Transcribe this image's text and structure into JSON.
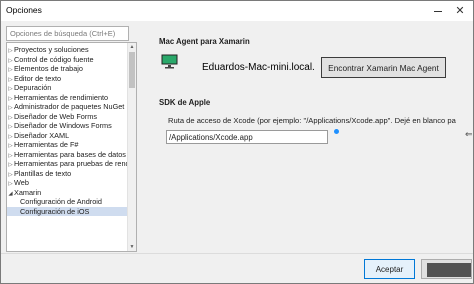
{
  "window": {
    "title": "Opciones"
  },
  "search": {
    "placeholder": "Opciones de búsqueda (Ctrl+E)"
  },
  "tree": {
    "items": [
      {
        "label": "Proyectos y soluciones",
        "expander": "▷",
        "level": 0,
        "selected": false
      },
      {
        "label": "Control de código fuente",
        "expander": "▷",
        "level": 0,
        "selected": false
      },
      {
        "label": "Elementos de trabajo",
        "expander": "▷",
        "level": 0,
        "selected": false
      },
      {
        "label": "Editor de texto",
        "expander": "▷",
        "level": 0,
        "selected": false
      },
      {
        "label": "Depuración",
        "expander": "▷",
        "level": 0,
        "selected": false
      },
      {
        "label": "Herramientas de rendimiento",
        "expander": "▷",
        "level": 0,
        "selected": false
      },
      {
        "label": "Administrador de paquetes NuGet",
        "expander": "▷",
        "level": 0,
        "selected": false
      },
      {
        "label": "Diseñador de Web Forms",
        "expander": "▷",
        "level": 0,
        "selected": false
      },
      {
        "label": "Diseñador de Windows Forms",
        "expander": "▷",
        "level": 0,
        "selected": false
      },
      {
        "label": "Diseñador XAML",
        "expander": "▷",
        "level": 0,
        "selected": false
      },
      {
        "label": "Herramientas de F#",
        "expander": "▷",
        "level": 0,
        "selected": false
      },
      {
        "label": "Herramientas para bases de datos",
        "expander": "▷",
        "level": 0,
        "selected": false
      },
      {
        "label": "Herramientas para pruebas de rendim",
        "expander": "▷",
        "level": 0,
        "selected": false
      },
      {
        "label": "Plantillas de texto",
        "expander": "▷",
        "level": 0,
        "selected": false
      },
      {
        "label": "Web",
        "expander": "▷",
        "level": 0,
        "selected": false
      },
      {
        "label": "Xamarin",
        "expander": "◢",
        "level": 0,
        "selected": false
      },
      {
        "label": "Configuración de Android",
        "expander": "",
        "level": 1,
        "selected": false
      },
      {
        "label": "Configuración de iOS",
        "expander": "",
        "level": 1,
        "selected": true
      }
    ]
  },
  "mac_agent": {
    "section_title": "Mac Agent para Xamarin",
    "agent_name": "Eduardos-Mac-mini.local.",
    "find_button": "Encontrar Xamarin Mac Agent"
  },
  "apple_sdk": {
    "section_title": "SDK de Apple",
    "xcode_label": "Ruta de acceso de Xcode (por ejemplo: \"/Applications/Xcode.app\". Dejé en blanco pa",
    "xcode_path": "/Applications/Xcode.app"
  },
  "footer": {
    "ok_button": "Aceptar"
  },
  "icons": {
    "minimize": "minimize-icon",
    "close": "close-icon",
    "computer": "computer-icon",
    "info": "info-icon"
  },
  "colors": {
    "selection": "#cfdcef",
    "accent": "#0078d7",
    "monitor_screen": "#2aa86a"
  }
}
